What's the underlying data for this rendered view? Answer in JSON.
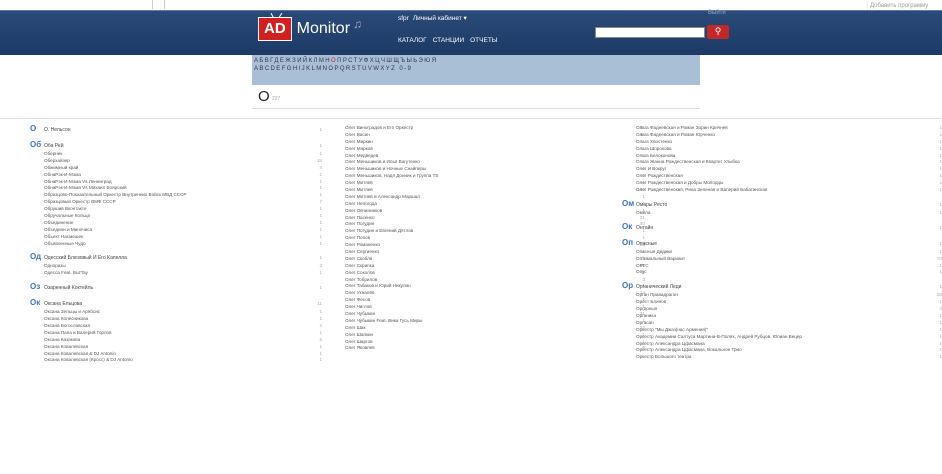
{
  "top_right_text": "Добавить программу",
  "header": {
    "logo_ad": "AD",
    "logo_text": "Monitor",
    "user": "sfpr",
    "cabinet": "Личный кабинет ▾",
    "logout": "Выйти",
    "nav": [
      "КАТАЛОГ",
      "СТАНЦИИ",
      "ОТЧЕТЫ"
    ],
    "search_value": "",
    "search_icon": "search-icon"
  },
  "alphabet": {
    "cyr": "АБВГДЕЖЗИЙКЛМНОПРСТУФХЦЧШЩЪЫЬЭЮЯ",
    "lat": "ABCDEFGHIJKLMNOPQRSTUVWXYZ 0-9",
    "active": "О"
  },
  "letter": {
    "char": "О",
    "count": "227"
  },
  "col1": [
    {
      "prefix": "О",
      "title": "О. Нельсон",
      "count": "1",
      "items": []
    },
    {
      "prefix": "Об",
      "title": "Оба Рей",
      "count": "1",
      "items": [
        [
          "Обернек",
          "1"
        ],
        [
          "Оберхайзер",
          "18"
        ],
        [
          "Обжимный край",
          "4"
        ],
        [
          "ОбнаРэк-И-Мэма",
          "1"
        ],
        [
          "ОбнаРэк-И-Мэма Vs Ленинград",
          "1"
        ],
        [
          "ОбнаРэк-И-Мэма Vs Михаил Боярский",
          "1"
        ],
        [
          "Образцово-Показательный Оркестр Внутренних Войск МВД СССР",
          "1"
        ],
        [
          "Образцовый Оркестр ВМФ СССР",
          "7"
        ],
        [
          "Обрушив Вконтакте",
          "1"
        ],
        [
          "Обручальные Кольца",
          "1"
        ],
        [
          "Объединение",
          "1"
        ],
        [
          "Объедини и Миночиса",
          "1"
        ],
        [
          "Объект Насмешек",
          "1"
        ],
        [
          "Объявленные Чудо",
          "1"
        ]
      ]
    },
    {
      "prefix": "Од",
      "title": "Одесский Блюзовый И Его Капелла",
      "count": "1",
      "items": [
        [
          "Одноразы",
          "3"
        ],
        [
          "Одесса Feat. BuzTay",
          "1"
        ]
      ]
    },
    {
      "prefix": "Оз",
      "title": "Озаренный Коктейль",
      "count": "1",
      "items": []
    },
    {
      "prefix": "Ок",
      "title": "Оксана Ельцова",
      "count": "11",
      "items": [
        [
          "Оксана Зельцы и Арябсис",
          "1"
        ],
        [
          "Оксана Колесникова",
          "1"
        ],
        [
          "Оксана Богословская",
          "2"
        ],
        [
          "Оксана Папа и Валерий Горлов",
          "1"
        ],
        [
          "Оксана Казакова",
          "5"
        ],
        [
          "Оксана Ковалевская",
          "1"
        ],
        [
          "Оксана Ковалевская & DJ Antonio",
          "1"
        ],
        [
          "Оксана Ковалевская (Кросс) & DJ Antonio",
          "1"
        ]
      ]
    }
  ],
  "col2": [
    [
      "Олег Виноградов и Его Оркестр",
      "31"
    ],
    [
      "Олег Васин",
      "15"
    ],
    [
      "Олег Маркин",
      "1"
    ],
    [
      "Олег Марков",
      "1"
    ],
    [
      "Олег Медведев",
      "2"
    ],
    [
      "Олег Меньшиков и Илья Вагутенко",
      "1"
    ],
    [
      "Олег Меньшиков и Ночные Снайперы",
      "1"
    ],
    [
      "Олег Меньшиков, Надя Донник и Группа TS",
      "1"
    ],
    [
      "Олег Митяев",
      "1"
    ],
    [
      "Олег Митяев",
      "160"
    ],
    [
      "Олег Митяев и Александр Маршал",
      "1"
    ],
    [
      "Олег Непогода",
      "1"
    ],
    [
      "Олег Овчинников",
      "1"
    ],
    [
      "Олег Пасенко",
      "31"
    ],
    [
      "Олег Погудин",
      "40"
    ],
    [
      "Олег Погудин и Евгений Дятлов",
      "1"
    ],
    [
      "Олег Попов",
      "1"
    ],
    [
      "Олег Романенко",
      "34"
    ],
    [
      "Олег Сергиенко",
      "1"
    ],
    [
      "Олег Скобля",
      "3"
    ],
    [
      "Олег Скрипка",
      "15"
    ],
    [
      "Олег Соколов",
      "1"
    ],
    [
      "Олег Тобрилов",
      "3"
    ],
    [
      "Олег Табаков и Юрий Никулин",
      "1"
    ],
    [
      "Олег Ухналёв",
      "14"
    ],
    [
      "Олег Фесов",
      "1"
    ],
    [
      "Олег Чиглов",
      "1"
    ],
    [
      "Олег Чубыкин",
      "31"
    ],
    [
      "Олег Чубыкин Feat. Вика Гусь Миры",
      "1"
    ],
    [
      "Олег Шак",
      "23"
    ],
    [
      "Олег Шапкин",
      "1"
    ],
    [
      "Олег Шаргов",
      "1"
    ],
    [
      "Олег Яковлев",
      "5"
    ]
  ],
  "col3": [
    {
      "prefix": "",
      "title": "",
      "count": "",
      "items": [
        [
          "Ольга Фадеевская и Роман Зорин Кричнев",
          "1"
        ],
        [
          "Ольга Фадеевская и Роман Юрченко",
          "1"
        ],
        [
          "Ольга Хвостенко",
          "1"
        ],
        [
          "Ольга Шорохова",
          "1"
        ],
        [
          "Ольга Белоконова",
          "1"
        ],
        [
          "Ольга Жанна Рождественская и Квартет Улыбка",
          "1"
        ],
        [
          "Олег И Вокруг",
          "1"
        ],
        [
          "Олег Рождественская",
          "1"
        ],
        [
          "Олег Рождественская и Добры Молодцы",
          "1"
        ],
        [
          "Олег Рождественская, Рина Зеленая и Валерий Бабатинская",
          "1"
        ]
      ]
    },
    {
      "prefix": "Ом",
      "title": "Омары Ресто",
      "count": "1",
      "items": [
        [
          "Омела",
          "1"
        ]
      ]
    },
    {
      "prefix": "Ок",
      "title": "Онтайн",
      "count": "1",
      "items": []
    },
    {
      "prefix": "Оп",
      "title": "Опасные",
      "count": "1",
      "items": [
        [
          "Опасные Дедики",
          "1"
        ],
        [
          "Оптимальный Вариант",
          "73"
        ],
        [
          "ОРТС",
          "1"
        ],
        [
          "Опус",
          "1"
        ]
      ]
    },
    {
      "prefix": "Ор",
      "title": "Органический Леди",
      "count": "1",
      "items": [
        [
          "Орган Правадрагон",
          "28"
        ],
        [
          "Орест Блинов",
          "1"
        ],
        [
          "Оргдоныя",
          "3"
        ],
        [
          "Органика",
          "1"
        ],
        [
          "Оргасан",
          "1"
        ],
        [
          "Оркестр \"Мы Джаз(нас Армения)\"",
          "1"
        ],
        [
          "Оркестр Академии Салтуса Мартина-В-Полях, Андрей Рубцов, Юлиан Вецер",
          "1"
        ],
        [
          "Оркестр Александра Цфасмана",
          "1"
        ],
        [
          "Оркестр Александра Цфасмана, Вокальное Трио",
          "1"
        ],
        [
          "Оркестр Большого театра",
          "1"
        ]
      ]
    }
  ]
}
